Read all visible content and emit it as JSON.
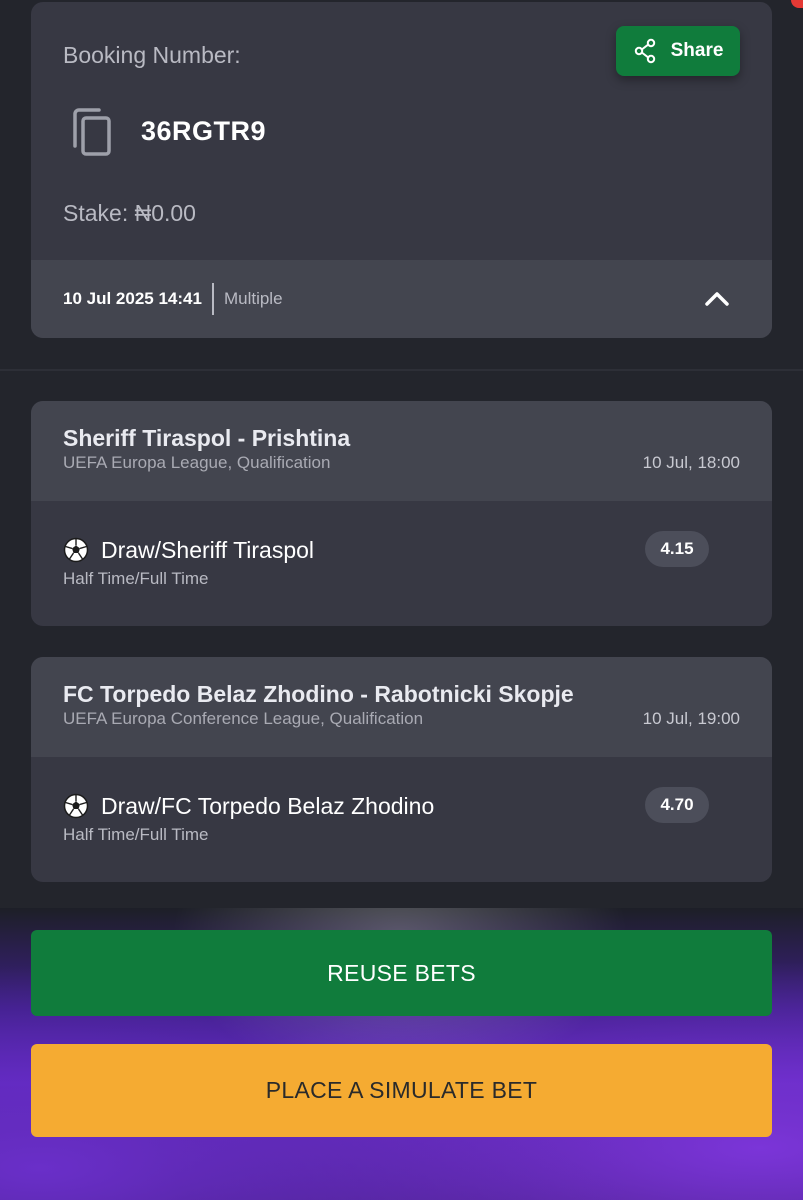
{
  "booking": {
    "label": "Booking Number:",
    "share_label": "Share",
    "code": "36RGTR9",
    "stake": "Stake: ₦0.00",
    "datetime": "10 Jul 2025 14:41",
    "bet_type": "Multiple"
  },
  "matches": [
    {
      "title": "Sheriff Tiraspol - Prishtina",
      "competition": "UEFA Europa League, Qualification",
      "time": "10 Jul, 18:00",
      "selection": "Draw/Sheriff Tiraspol",
      "market": "Half Time/Full Time",
      "odds": "4.15"
    },
    {
      "title": "FC Torpedo Belaz Zhodino - Rabotnicki Skopje",
      "competition": "UEFA Europa Conference League, Qualification",
      "time": "10 Jul, 19:00",
      "selection": "Draw/FC Torpedo Belaz Zhodino",
      "market": "Half Time/Full Time",
      "odds": "4.70"
    }
  ],
  "actions": {
    "reuse_label": "REUSE BETS",
    "simulate_label": "PLACE A SIMULATE BET"
  },
  "icons": {
    "share": "share-icon",
    "copy": "copy-icon",
    "chevron": "chevron-up-icon",
    "ball": "soccer-ball-icon"
  },
  "colors": {
    "accent_green": "#107c3c",
    "accent_orange": "#f5ab32",
    "card_bg": "#373843",
    "page_bg": "#23252c"
  }
}
